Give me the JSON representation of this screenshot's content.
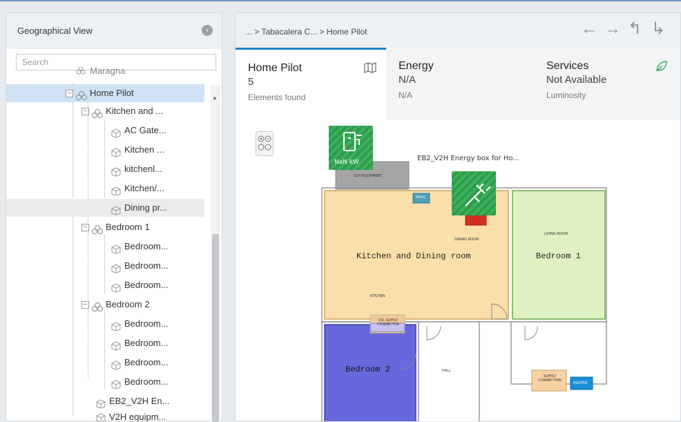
{
  "left_panel": {
    "title": "Geographical View",
    "collapse_icon": "chevron-left-icon",
    "search_placeholder": "Search",
    "tree": [
      {
        "label": "Maragna",
        "level": 1
      },
      {
        "label": "Home Pilot",
        "level": 1,
        "selected": true
      },
      {
        "label": "Kitchen and ...",
        "level": 2
      },
      {
        "label": "AC Gate...",
        "level": 3
      },
      {
        "label": "Kitchen ...",
        "level": 3
      },
      {
        "label": "kitchenl...",
        "level": 3
      },
      {
        "label": "Kitchen/...",
        "level": 3
      },
      {
        "label": "Dining pr...",
        "level": 3,
        "highlighted": true
      },
      {
        "label": "Bedroom 1",
        "level": 2
      },
      {
        "label": "Bedroom...",
        "level": 3
      },
      {
        "label": "Bedroom...",
        "level": 3
      },
      {
        "label": "Bedroom...",
        "level": 3
      },
      {
        "label": "Bedroom 2",
        "level": 2
      },
      {
        "label": "Bedroom...",
        "level": 3
      },
      {
        "label": "Bedroom...",
        "level": 3
      },
      {
        "label": "Bedroom...",
        "level": 3
      },
      {
        "label": "Bedroom...",
        "level": 3
      },
      {
        "label": "EB2_V2H En...",
        "level": 2
      },
      {
        "label": "V2H equipm...",
        "level": 2
      }
    ]
  },
  "right_panel": {
    "breadcrumb": "... > Tabacalera C... > Home Pilot",
    "nav_icons": [
      "back-arrow-icon",
      "forward-arrow-icon",
      "up-arrow-icon",
      "redo-arrow-icon"
    ],
    "tabs": [
      {
        "title": "Home Pilot",
        "value": "5",
        "sub": "Elements found",
        "icon": "map-icon"
      },
      {
        "title": "Energy",
        "value": "N/A",
        "sub": "N/A"
      },
      {
        "title": "Services",
        "value": "Not Available",
        "sub": "Luminosity",
        "icon": "leaf-icon"
      }
    ]
  },
  "plan": {
    "meter_label": "NaN kW",
    "energy_box_label": "EB2_V2H Energy box for Ho...",
    "v2h_equipment": "V2H EQUIPMENT",
    "rack": "RACK",
    "dining_room": "DINING ROOM",
    "kitchen_dining": "Kitchen and Dining room",
    "living_room": "LIVING ROOM",
    "bedroom1": "Bedroom 1",
    "kitchen": "KITCHEN",
    "supply_connector": "V2L SUPPLY CONNECTOR",
    "bedroom2": "Bedroom 2",
    "hall": "HALL",
    "supply_connection": "SUPPLY CONNECTION",
    "router": "ROUTER",
    "colors": {
      "kitchen": "#fbdfab",
      "bedroom1": "#dff1c1",
      "bedroom2": "#6868dd",
      "device": "#3bb05a"
    }
  }
}
